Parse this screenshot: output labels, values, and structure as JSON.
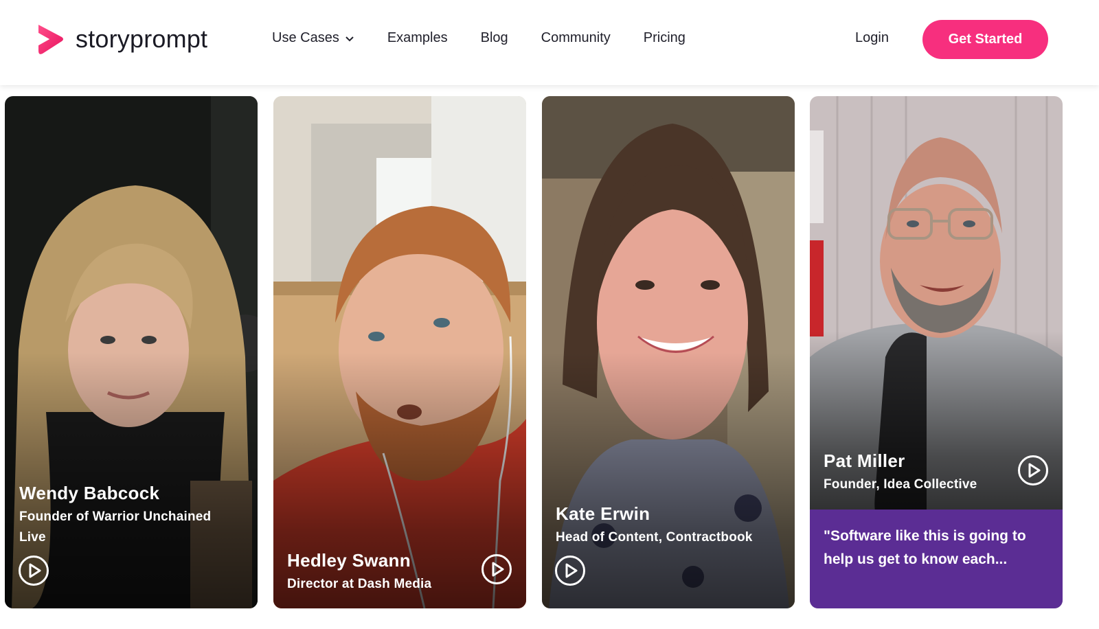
{
  "brand": {
    "name": "storyprompt",
    "accent": "#f72f7e"
  },
  "nav": {
    "items": [
      {
        "label": "Use Cases",
        "has_dropdown": true
      },
      {
        "label": "Examples"
      },
      {
        "label": "Blog"
      },
      {
        "label": "Community"
      },
      {
        "label": "Pricing"
      }
    ],
    "login": "Login",
    "cta": "Get Started"
  },
  "cards": [
    {
      "name": "Wendy Babcock",
      "role_line1": "Founder of Warrior Unchained",
      "role_line2": "Live",
      "icon": "play-icon"
    },
    {
      "name": "Hedley Swann",
      "role_line1": "Director at Dash Media",
      "icon": "play-icon"
    },
    {
      "name": "Kate Erwin",
      "role_line1": "Head of Content, Contractbook",
      "icon": "play-icon"
    },
    {
      "name": "Pat Miller",
      "role_line1": "Founder, Idea Collective",
      "quote": "\"Software like this is going to help us get to know each...",
      "icon": "play-icon",
      "quote_color": "#5b2d94"
    }
  ]
}
